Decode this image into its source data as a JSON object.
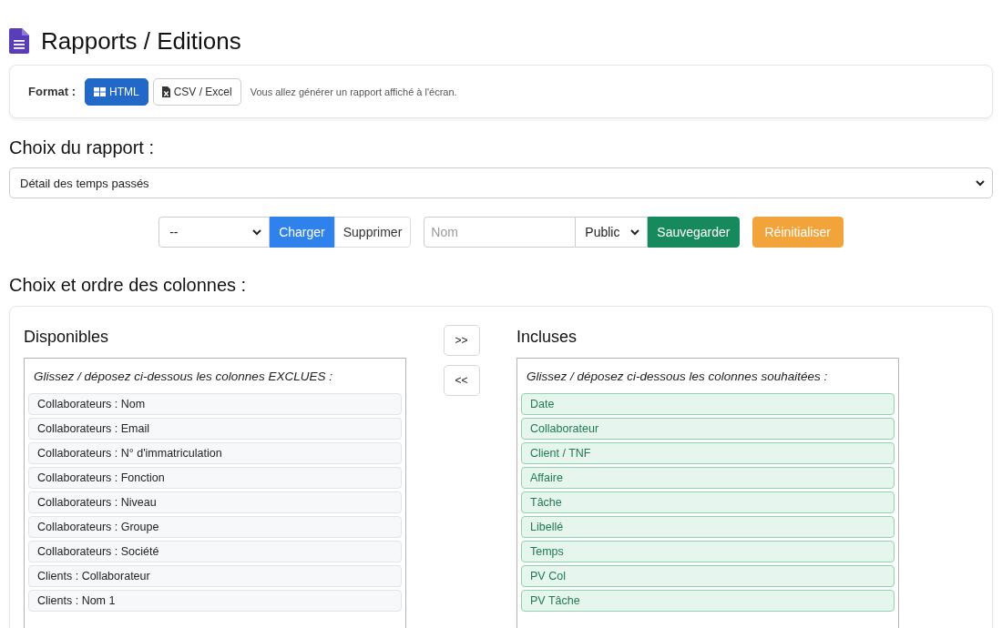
{
  "page": {
    "title": "Rapports / Editions"
  },
  "format": {
    "label": "Format :",
    "options": [
      {
        "label": "HTML",
        "selected": true
      },
      {
        "label": "CSV / Excel",
        "selected": false
      }
    ],
    "hint": "Vous allez générer un rapport affiché à l'écran."
  },
  "report": {
    "heading": "Choix du rapport :",
    "value": "Détail des temps passés"
  },
  "presets": {
    "select_value": "--",
    "load": "Charger",
    "delete": "Supprimer",
    "name_placeholder": "Nom",
    "visibility": "Public",
    "save": "Sauvegarder",
    "reset": "Réinitialiser"
  },
  "columns": {
    "heading": "Choix et ordre des colonnes :",
    "move_right": ">>",
    "move_left": "<<",
    "available": {
      "title": "Disponibles",
      "hint": "Glissez / déposez ci-dessous les colonnes EXCLUES :",
      "items": [
        "Collaborateurs : Nom",
        "Collaborateurs : Email",
        "Collaborateurs : N° d'immatriculation",
        "Collaborateurs : Fonction",
        "Collaborateurs : Niveau",
        "Collaborateurs : Groupe",
        "Collaborateurs : Société",
        "Clients : Collaborateur",
        "Clients : Nom 1"
      ]
    },
    "included": {
      "title": "Incluses",
      "hint": "Glissez / déposez ci-dessous les colonnes souhaitées :",
      "items": [
        "Date",
        "Collaborateur",
        "Client / TNF",
        "Affaire",
        "Tâche",
        "Libellé",
        "Temps",
        "PV Col",
        "PV Tâche"
      ]
    }
  }
}
